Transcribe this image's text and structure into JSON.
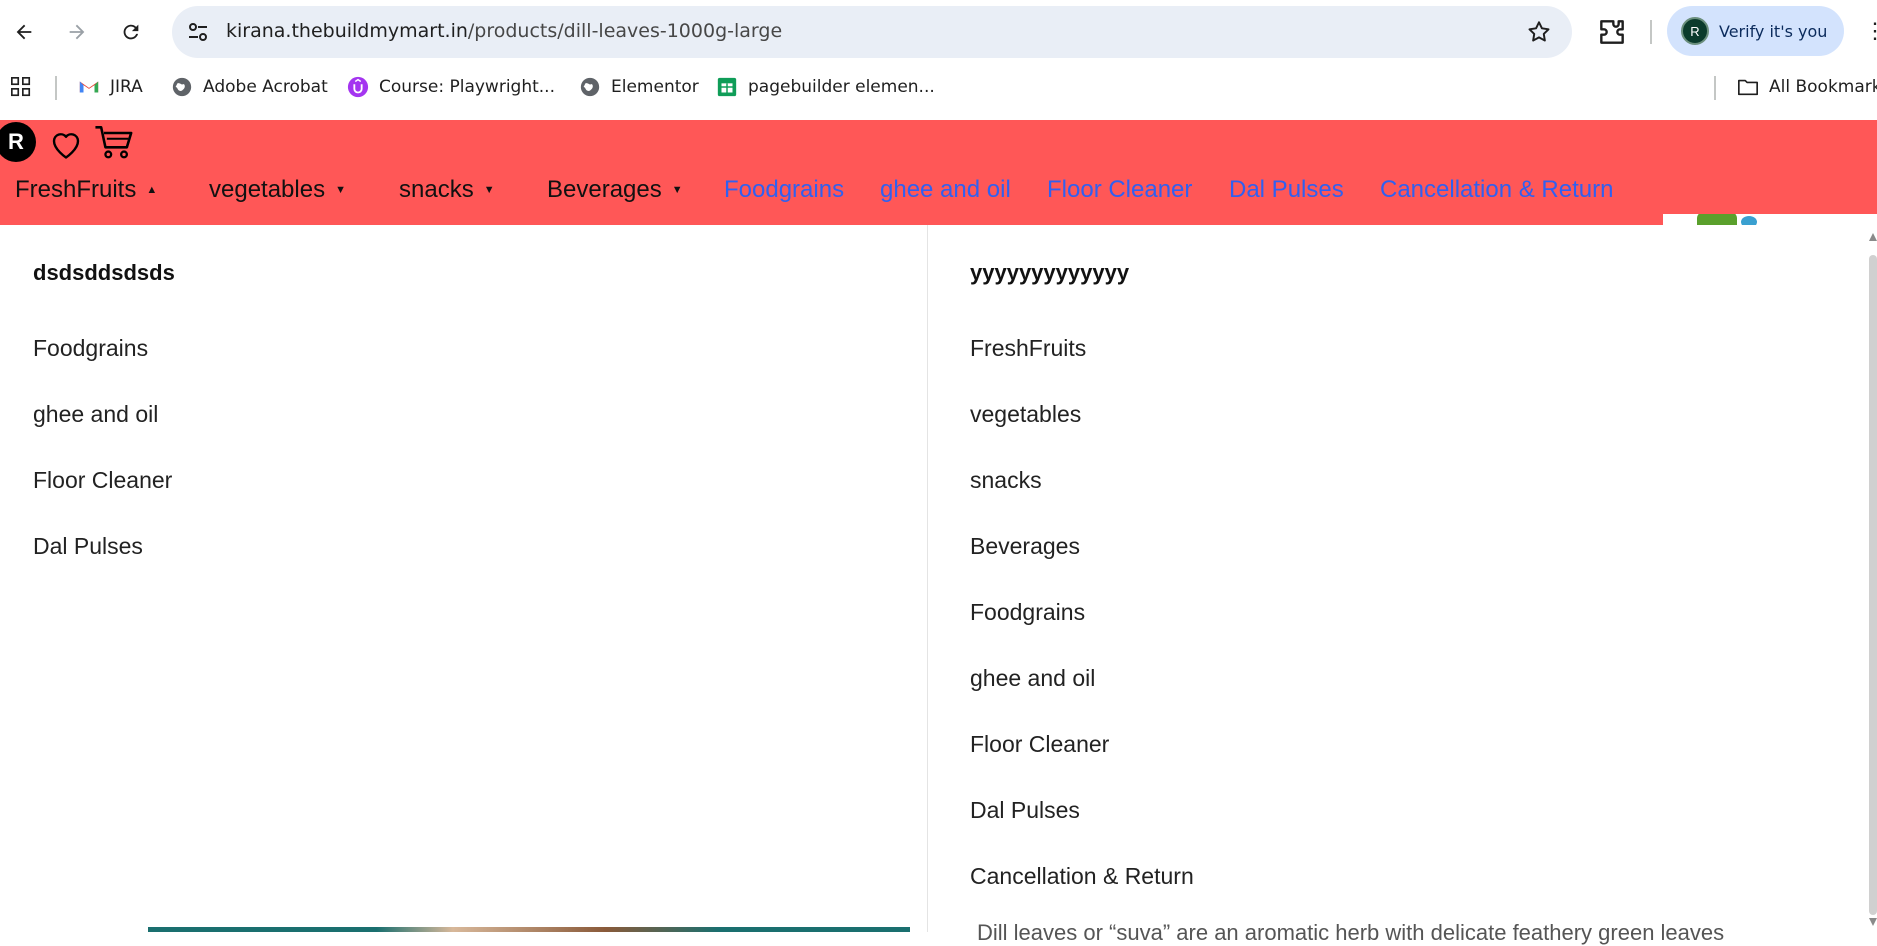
{
  "browser": {
    "url_domain": "kirana.thebuildmymart.in",
    "url_path": "/products/dill-leaves-1000g-large",
    "profile_initial": "R",
    "verify_label": "Verify it's you"
  },
  "bookmarks": [
    {
      "label": "JIRA",
      "icon": "gmail-icon"
    },
    {
      "label": "Adobe Acrobat",
      "icon": "globe-icon"
    },
    {
      "label": "Course: Playwright...",
      "icon": "udemy-icon"
    },
    {
      "label": "Elementor",
      "icon": "globe-icon"
    },
    {
      "label": "pagebuilder elemen...",
      "icon": "sheets-icon"
    }
  ],
  "all_bookmarks_label": "All Bookmarks",
  "site": {
    "logo_letter": "R",
    "accent_color": "#ff5757",
    "link_color": "#3060f0",
    "nav": [
      {
        "label": "FreshFruits",
        "dropdown": true,
        "open": true
      },
      {
        "label": "vegetables",
        "dropdown": true
      },
      {
        "label": "snacks",
        "dropdown": true
      },
      {
        "label": "Beverages",
        "dropdown": true
      },
      {
        "label": "Foodgrains",
        "dropdown": false
      },
      {
        "label": "ghee and oil",
        "dropdown": false
      },
      {
        "label": "Floor Cleaner",
        "dropdown": false
      },
      {
        "label": "Dal Pulses",
        "dropdown": false
      },
      {
        "label": "Cancellation & Return",
        "dropdown": false
      }
    ]
  },
  "mega_menu": {
    "left": {
      "title": "dsdsddsdsds",
      "links": [
        "Foodgrains",
        "ghee and oil",
        "Floor Cleaner",
        "Dal Pulses"
      ]
    },
    "right": {
      "title": "yyyyyyyyyyyyy",
      "links": [
        "FreshFruits",
        "vegetables",
        "snacks",
        "Beverages",
        "Foodgrains",
        "ghee and oil",
        "Floor Cleaner",
        "Dal Pulses",
        "Cancellation & Return"
      ]
    }
  },
  "peek_text": "Dill leaves or “suva” are an aromatic herb with delicate feathery green leaves"
}
